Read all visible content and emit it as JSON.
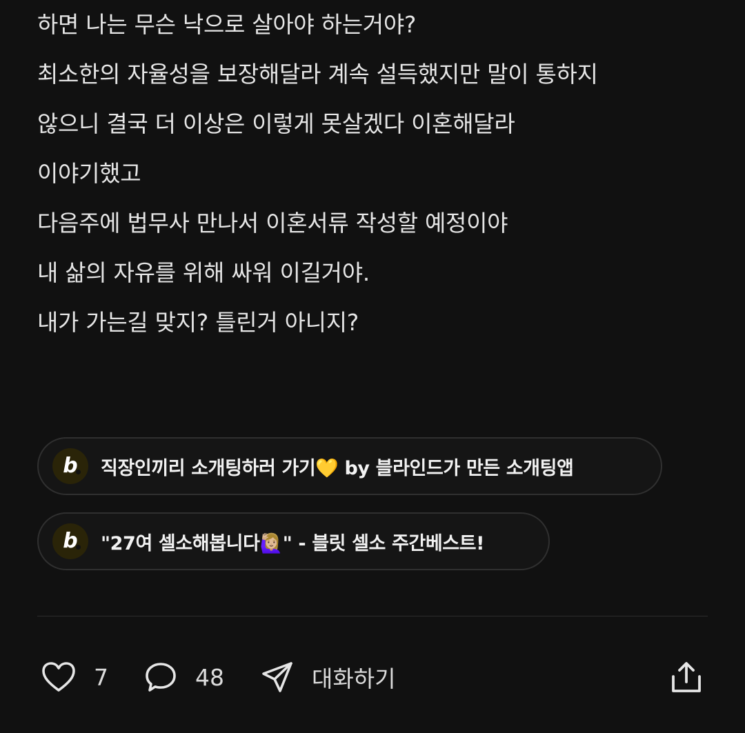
{
  "post": {
    "lines": [
      "하면 나는 무슨 낙으로 살아야 하는거야?",
      "최소한의 자율성을 보장해달라 계속 설득했지만 말이 통하지",
      "않으니 결국 더 이상은 이렇게 못살겠다 이혼해달라",
      "이야기했고",
      "다음주에 법무사 만나서 이혼서류 작성할 예정이야",
      "내 삶의 자유를 위해 싸워 이길거야.",
      "내가 가는길 맞지? 틀린거 아니지?"
    ]
  },
  "promos": [
    {
      "logo": "b",
      "text": "직장인끼리 소개팅하러 가기💛 by 블라인드가 만든 소개팅앱"
    },
    {
      "logo": "b",
      "text": "\"27여 셀소해봅니다🙋🏼‍♀️\" - 블릿 셀소 주간베스트!"
    }
  ],
  "actions": {
    "like_icon": "heart-icon",
    "like_count": "7",
    "comment_icon": "speech-bubble-icon",
    "comment_count": "48",
    "chat_icon": "send-icon",
    "chat_label": "대화하기",
    "share_icon": "share-icon"
  },
  "colors": {
    "background": "#111111",
    "text": "#e6e6e6",
    "pill_border": "#303030",
    "logo_bg": "#2a2408"
  }
}
